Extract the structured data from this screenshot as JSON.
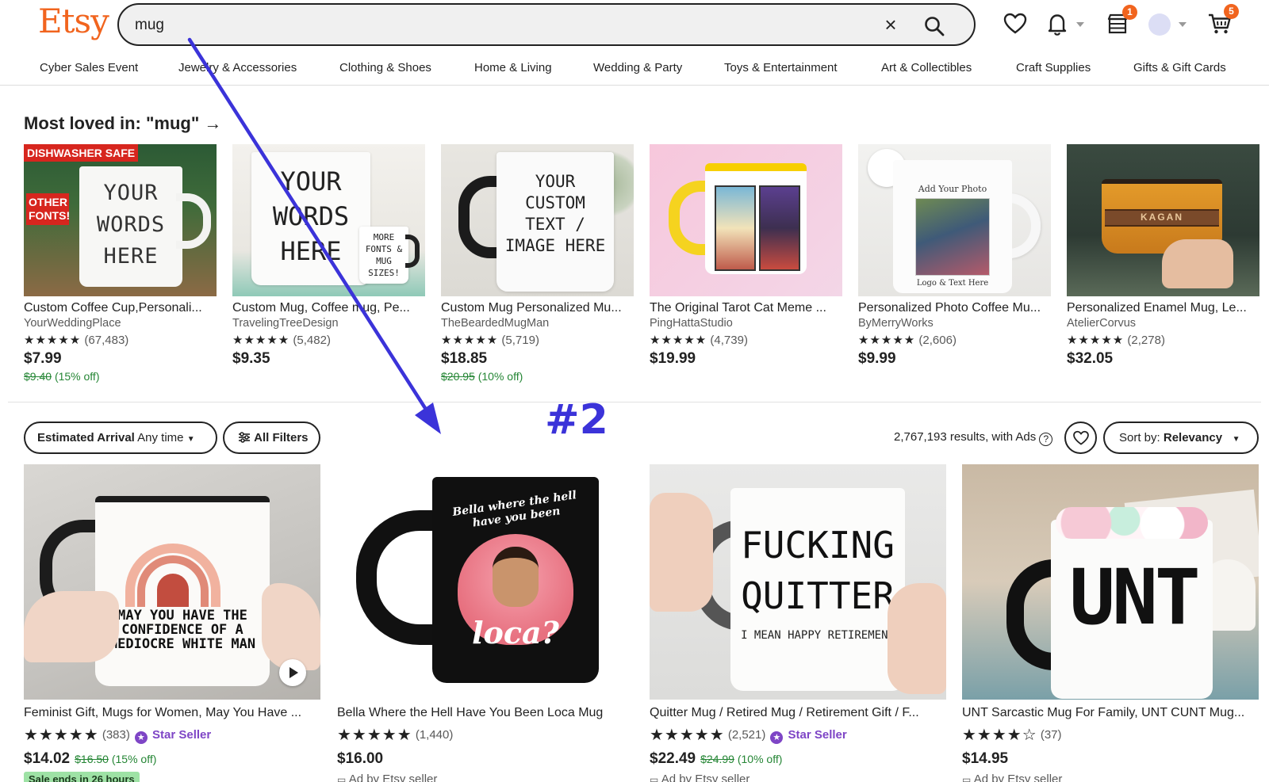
{
  "header": {
    "logo": "Etsy",
    "search_value": "mug",
    "notif_count": "1",
    "cart_count": "5"
  },
  "categories": [
    "Cyber Sales Event",
    "Jewelry & Accessories",
    "Clothing & Shoes",
    "Home & Living",
    "Wedding & Party",
    "Toys & Entertainment",
    "Art & Collectibles",
    "Craft Supplies",
    "Gifts & Gift Cards"
  ],
  "most_loved": {
    "title": "Most loved in: \"mug\" →",
    "items": [
      {
        "name": "Custom Coffee Cup,Personali...",
        "shop": "YourWeddingPlace",
        "reviews": "(67,483)",
        "price": "$7.99",
        "orig": "$9.40",
        "discount": "(15% off)",
        "img_text": "YOUR WORDS HERE",
        "tag": "DISHWASHER SAFE",
        "tag2": "OTHER FONTS!"
      },
      {
        "name": "Custom Mug, Coffee mug, Pe...",
        "shop": "TravelingTreeDesign",
        "reviews": "(5,482)",
        "price": "$9.35",
        "orig": "",
        "discount": "",
        "img_text": "YOUR WORDS HERE",
        "small_text": "MORE FONTS & MUG SIZES!"
      },
      {
        "name": "Custom Mug Personalized Mu...",
        "shop": "TheBeardedMugMan",
        "reviews": "(5,719)",
        "price": "$18.85",
        "orig": "$20.95",
        "discount": "(10% off)",
        "img_text": "YOUR CUSTOM TEXT / IMAGE HERE"
      },
      {
        "name": "The Original Tarot Cat Meme ...",
        "shop": "PingHattaStudio",
        "reviews": "(4,739)",
        "price": "$19.99",
        "orig": "",
        "discount": ""
      },
      {
        "name": "Personalized Photo Coffee Mu...",
        "shop": "ByMerryWorks",
        "reviews": "(2,606)",
        "price": "$9.99",
        "orig": "",
        "discount": "",
        "img_text": "Add Your Photo",
        "img_text2": "Logo & Text Here"
      },
      {
        "name": "Personalized Enamel Mug, Le...",
        "shop": "AtelierCorvus",
        "reviews": "(2,278)",
        "price": "$32.05",
        "orig": "",
        "discount": "",
        "img_text": "KAGAN"
      }
    ]
  },
  "annotation": {
    "label": "#2"
  },
  "filters": {
    "arrival_label": "Estimated Arrival",
    "arrival_value": "Any time",
    "all_filters": "All Filters",
    "results": "2,767,193 results, with Ads",
    "sort_label": "Sort by:",
    "sort_value": "Relevancy"
  },
  "products": [
    {
      "name": "Feminist Gift, Mugs for Women, May You Have ...",
      "reviews": "(383)",
      "star_seller": "Star Seller",
      "price": "$14.02",
      "orig": "$16.50",
      "discount": "(15% off)",
      "sale": "Sale ends in 26 hours",
      "ad": "",
      "img_text": "MAY YOU HAVE THE CONFIDENCE OF A MEDIOCRE WHITE MAN"
    },
    {
      "name": "Bella Where the Hell Have You Been Loca Mug",
      "reviews": "(1,440)",
      "star_seller": "",
      "price": "$16.00",
      "orig": "",
      "discount": "",
      "sale": "",
      "ad": "Ad by Etsy seller",
      "img_text": "Bella where the hell have you been",
      "img_text2": "loca?"
    },
    {
      "name": "Quitter Mug / Retired Mug / Retirement Gift / F...",
      "reviews": "(2,521)",
      "star_seller": "Star Seller",
      "price": "$22.49",
      "orig": "$24.99",
      "discount": "(10% off)",
      "sale": "",
      "ad": "Ad by Etsy seller",
      "img_text": "FUCKING QUITTER",
      "img_text2": "I MEAN HAPPY RETIREMENT"
    },
    {
      "name": "UNT Sarcastic Mug For Family, UNT CUNT Mug...",
      "reviews": "(37)",
      "star_seller": "",
      "price": "$14.95",
      "orig": "",
      "discount": "",
      "sale": "",
      "ad": "Ad by Etsy seller",
      "img_text": "UNT"
    }
  ]
}
